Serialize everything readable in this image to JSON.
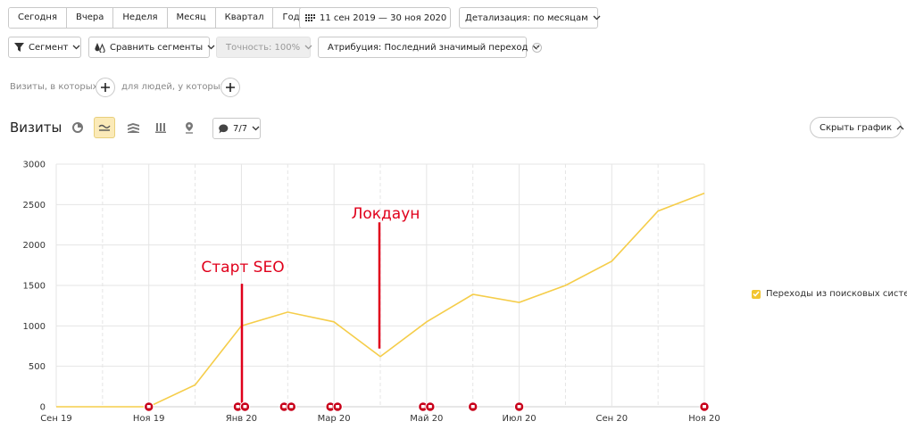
{
  "periods": [
    "Сегодня",
    "Вчера",
    "Неделя",
    "Месяц",
    "Квартал",
    "Год"
  ],
  "date_range": "11 сен 2019 — 30 ноя 2020",
  "detail": "Детализация: по месяцам",
  "segment_label": "Сегмент",
  "compare_label": "Сравнить сегменты",
  "accuracy_label": "Точность: 100%",
  "attribution_label": "Атрибуция: Последний значимый переход",
  "filter_visits_label": "Визиты, в которых",
  "filter_people_label": "для людей, у которых",
  "chart_title": "Визиты",
  "annotations_count": "7/7",
  "hide_chart_label": "Скрыть график",
  "colors": {
    "line": "#f5cd4a",
    "annotation": "#e0001b",
    "grid": "#e5e5e5",
    "legend": "#f2c531"
  },
  "chart_data": {
    "type": "line",
    "x": [
      "Сен 19",
      "Окт 19",
      "Ноя 19",
      "Дек 19",
      "Янв 20",
      "Фев 20",
      "Мар 20",
      "Апр 20",
      "Май 20",
      "Июн 20",
      "Июл 20",
      "Авг 20",
      "Сен 20",
      "Окт 20",
      "Ноя 20"
    ],
    "x_tick_labels": [
      "Сен 19",
      "Ноя 19",
      "Янв 20",
      "Мар 20",
      "Май 20",
      "Июл 20",
      "Сен 20",
      "Ноя 20"
    ],
    "y_ticks": [
      0,
      500,
      1000,
      1500,
      2000,
      2500,
      3000
    ],
    "ylim": [
      0,
      3000
    ],
    "series": [
      {
        "name": "Переходы из поисковых систем",
        "values": [
          0,
          0,
          0,
          270,
          1000,
          1170,
          1050,
          620,
          1050,
          1390,
          1290,
          1500,
          1800,
          2420,
          2640
        ]
      }
    ],
    "annotations": [
      {
        "text": "Старт SEO",
        "x": "Янв 20",
        "from": 0,
        "to": 1520
      },
      {
        "text": "Локдаун",
        "x": "Апр 20",
        "from": 720,
        "to": 2280
      }
    ],
    "markers": [
      {
        "x": "Ноя 19",
        "count": 1
      },
      {
        "x": "Янв 20",
        "count": 2
      },
      {
        "x": "Фев 20",
        "count": 2
      },
      {
        "x": "Мар 20",
        "count": 2
      },
      {
        "x": "Май 20",
        "count": 2
      },
      {
        "x": "Июн 20",
        "count": 1
      },
      {
        "x": "Июл 20",
        "count": 1
      },
      {
        "x": "Ноя 20",
        "count": 1
      }
    ],
    "grid": true,
    "legend": "right"
  }
}
